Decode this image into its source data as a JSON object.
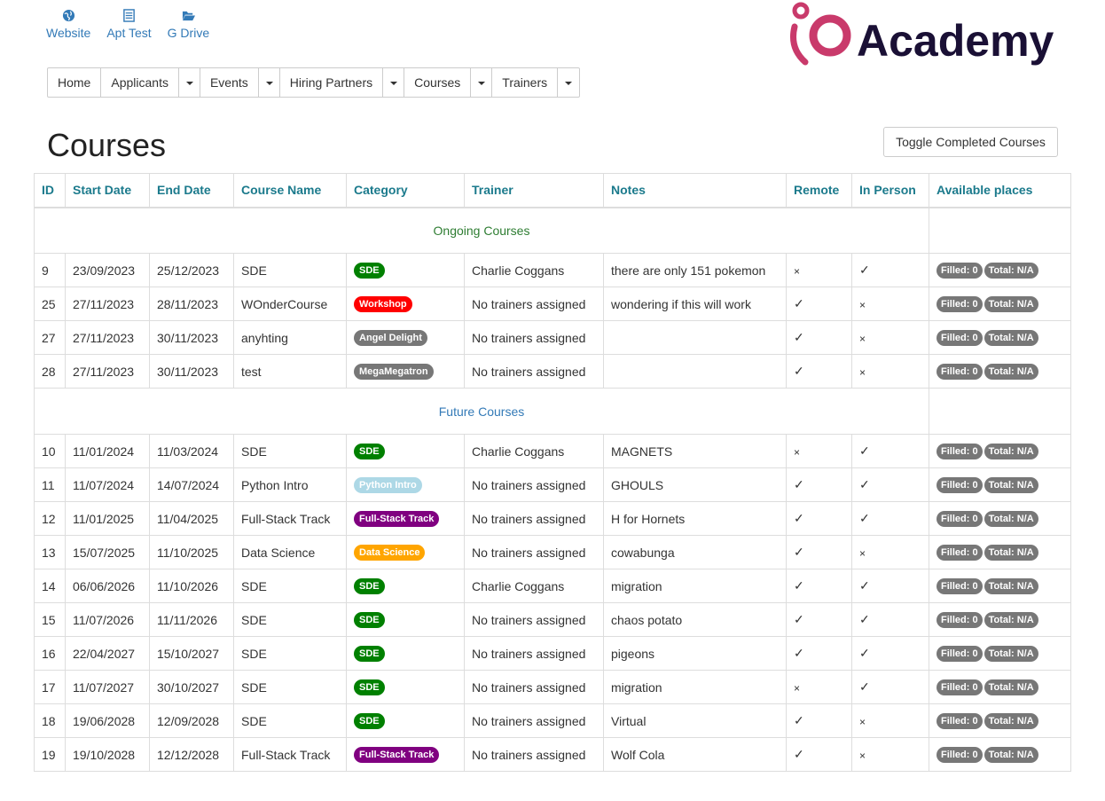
{
  "top_links": [
    {
      "label": "Website",
      "icon": "globe-icon"
    },
    {
      "label": "Apt Test",
      "icon": "list-icon"
    },
    {
      "label": "G Drive",
      "icon": "folder-open-icon"
    }
  ],
  "logo": {
    "text": "Academy",
    "mark": "iO",
    "brand_color": "#c93a6b",
    "text_color": "#1a1035"
  },
  "nav": [
    {
      "label": "Home",
      "caret": false
    },
    {
      "label": "Applicants",
      "caret": true
    },
    {
      "label": "Events",
      "caret": true
    },
    {
      "label": "Hiring Partners",
      "caret": true
    },
    {
      "label": "Courses",
      "caret": true
    },
    {
      "label": "Trainers",
      "caret": true
    }
  ],
  "page_title": "Courses",
  "toggle_label": "Toggle Completed Courses",
  "table": {
    "headers": [
      "ID",
      "Start Date",
      "End Date",
      "Course Name",
      "Category",
      "Trainer",
      "Notes",
      "Remote",
      "In Person",
      "Available places"
    ],
    "sections": [
      {
        "title": "Ongoing Courses",
        "rows": [
          {
            "id": "9",
            "start": "23/09/2023",
            "end": "25/12/2023",
            "name": "SDE",
            "category": "SDE",
            "cat_color": "#008000",
            "trainer": "Charlie Coggans",
            "notes": "there are only 151 pokemon",
            "remote": "×",
            "in_person": "✓",
            "filled": "Filled: 0",
            "total": "Total: N/A"
          },
          {
            "id": "25",
            "start": "27/11/2023",
            "end": "28/11/2023",
            "name": "WOnderCourse",
            "category": "Workshop",
            "cat_color": "#ff0000",
            "trainer": "No trainers assigned",
            "notes": "wondering if this will work",
            "remote": "✓",
            "in_person": "×",
            "filled": "Filled: 0",
            "total": "Total: N/A"
          },
          {
            "id": "27",
            "start": "27/11/2023",
            "end": "30/11/2023",
            "name": "anyhting",
            "category": "Angel Delight",
            "cat_color": "#777777",
            "trainer": "No trainers assigned",
            "notes": "",
            "remote": "✓",
            "in_person": "×",
            "filled": "Filled: 0",
            "total": "Total: N/A"
          },
          {
            "id": "28",
            "start": "27/11/2023",
            "end": "30/11/2023",
            "name": "test",
            "category": "MegaMegatron",
            "cat_color": "#777777",
            "trainer": "No trainers assigned",
            "notes": "",
            "remote": "✓",
            "in_person": "×",
            "filled": "Filled: 0",
            "total": "Total: N/A"
          }
        ]
      },
      {
        "title": "Future Courses",
        "rows": [
          {
            "id": "10",
            "start": "11/01/2024",
            "end": "11/03/2024",
            "name": "SDE",
            "category": "SDE",
            "cat_color": "#008000",
            "trainer": "Charlie Coggans",
            "notes": "MAGNETS",
            "remote": "×",
            "in_person": "✓",
            "filled": "Filled: 0",
            "total": "Total: N/A"
          },
          {
            "id": "11",
            "start": "11/07/2024",
            "end": "14/07/2024",
            "name": "Python Intro",
            "category": "Python Intro",
            "cat_color": "#add8e6",
            "trainer": "No trainers assigned",
            "notes": "GHOULS",
            "remote": "✓",
            "in_person": "✓",
            "filled": "Filled: 0",
            "total": "Total: N/A"
          },
          {
            "id": "12",
            "start": "11/01/2025",
            "end": "11/04/2025",
            "name": "Full-Stack Track",
            "category": "Full-Stack Track",
            "cat_color": "#800080",
            "trainer": "No trainers assigned",
            "notes": "H for Hornets",
            "remote": "✓",
            "in_person": "✓",
            "filled": "Filled: 0",
            "total": "Total: N/A"
          },
          {
            "id": "13",
            "start": "15/07/2025",
            "end": "11/10/2025",
            "name": "Data Science",
            "category": "Data Science",
            "cat_color": "#ffa500",
            "trainer": "No trainers assigned",
            "notes": "cowabunga",
            "remote": "✓",
            "in_person": "×",
            "filled": "Filled: 0",
            "total": "Total: N/A"
          },
          {
            "id": "14",
            "start": "06/06/2026",
            "end": "11/10/2026",
            "name": "SDE",
            "category": "SDE",
            "cat_color": "#008000",
            "trainer": "Charlie Coggans",
            "notes": "migration",
            "remote": "✓",
            "in_person": "✓",
            "filled": "Filled: 0",
            "total": "Total: N/A"
          },
          {
            "id": "15",
            "start": "11/07/2026",
            "end": "11/11/2026",
            "name": "SDE",
            "category": "SDE",
            "cat_color": "#008000",
            "trainer": "No trainers assigned",
            "notes": "chaos potato",
            "remote": "✓",
            "in_person": "✓",
            "filled": "Filled: 0",
            "total": "Total: N/A"
          },
          {
            "id": "16",
            "start": "22/04/2027",
            "end": "15/10/2027",
            "name": "SDE",
            "category": "SDE",
            "cat_color": "#008000",
            "trainer": "No trainers assigned",
            "notes": "pigeons",
            "remote": "✓",
            "in_person": "✓",
            "filled": "Filled: 0",
            "total": "Total: N/A"
          },
          {
            "id": "17",
            "start": "11/07/2027",
            "end": "30/10/2027",
            "name": "SDE",
            "category": "SDE",
            "cat_color": "#008000",
            "trainer": "No trainers assigned",
            "notes": "migration",
            "remote": "×",
            "in_person": "✓",
            "filled": "Filled: 0",
            "total": "Total: N/A"
          },
          {
            "id": "18",
            "start": "19/06/2028",
            "end": "12/09/2028",
            "name": "SDE",
            "category": "SDE",
            "cat_color": "#008000",
            "trainer": "No trainers assigned",
            "notes": "Virtual",
            "remote": "✓",
            "in_person": "×",
            "filled": "Filled: 0",
            "total": "Total: N/A"
          },
          {
            "id": "19",
            "start": "19/10/2028",
            "end": "12/12/2028",
            "name": "Full-Stack Track",
            "category": "Full-Stack Track",
            "cat_color": "#800080",
            "trainer": "No trainers assigned",
            "notes": "Wolf Cola",
            "remote": "✓",
            "in_person": "×",
            "filled": "Filled: 0",
            "total": "Total: N/A"
          }
        ]
      }
    ]
  }
}
